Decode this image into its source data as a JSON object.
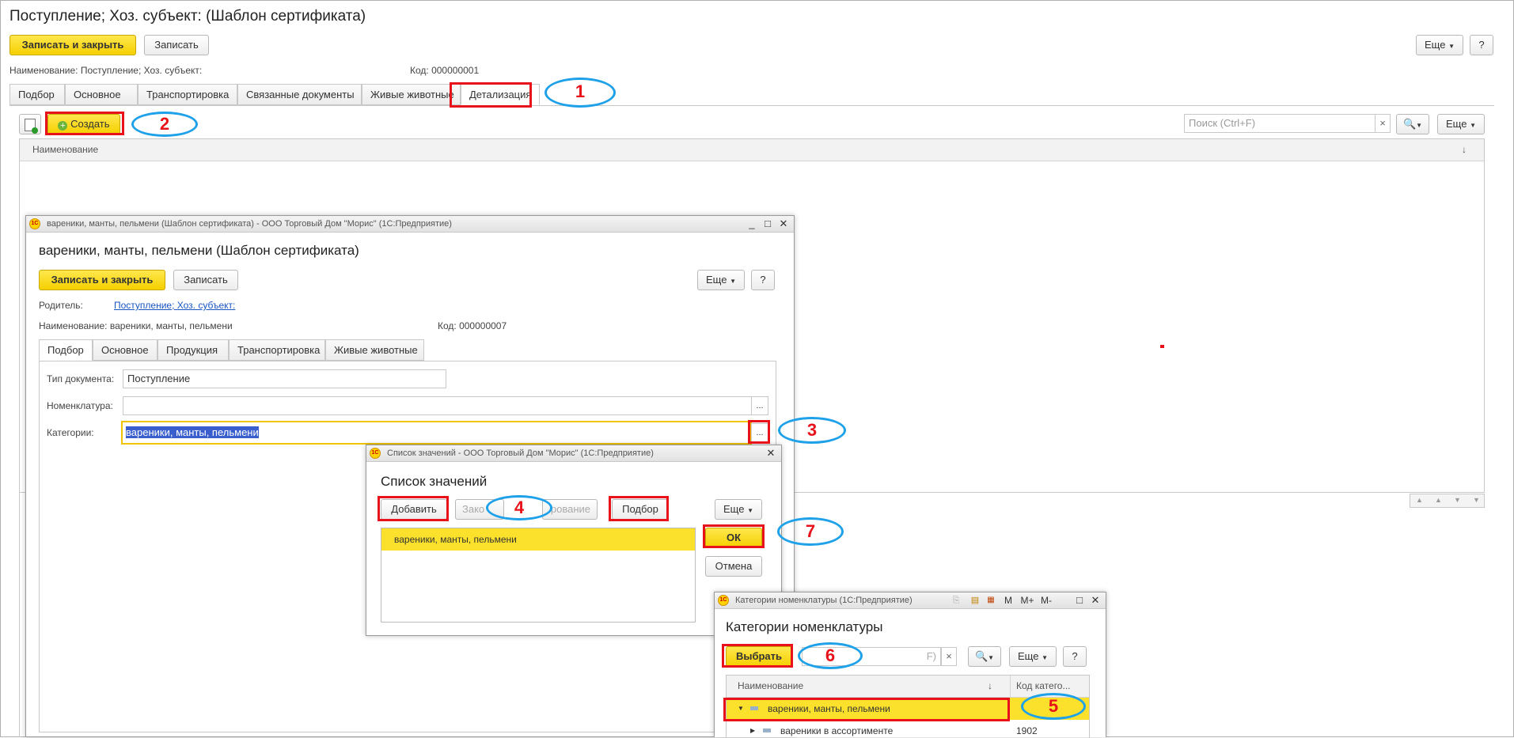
{
  "main": {
    "title": "Поступление; Хоз. субъект: (Шаблон сертификата)",
    "save_close": "Записать и закрыть",
    "save": "Записать",
    "more": "Еще",
    "help": "?",
    "name_label": "Наименование: Поступление; Хоз. субъект:",
    "code_label": "Код: 000000001",
    "tabs": [
      "Подбор",
      "Основное",
      "Транспортировка",
      "Связанные документы",
      "Живые животные",
      "Детализация"
    ],
    "create": "Создать",
    "search_placeholder": "Поиск (Ctrl+F)",
    "search_clear": "×",
    "more2": "Еще",
    "col_name": "Наименование",
    "sort_arrow": "↓"
  },
  "win1": {
    "titlebar": "вареники, манты, пельмени (Шаблон сертификата) - ООО Торговый Дом \"Морис\"  (1С:Предприятие)",
    "title": "вареники, манты, пельмени (Шаблон сертификата)",
    "save_close": "Записать и закрыть",
    "save": "Записать",
    "more": "Еще",
    "help": "?",
    "parent_label": "Родитель:",
    "parent_value": "Поступление; Хоз. субъект:",
    "name_label": "Наименование: вареники, манты, пельмени",
    "code_label": "Код: 000000007",
    "tabs": [
      "Подбор",
      "Основное",
      "Продукция",
      "Транспортировка",
      "Живые животные"
    ],
    "doc_type_label": "Тип документа:",
    "doc_type_value": "Поступление",
    "nomen_label": "Номенклатура:",
    "nomen_value": "",
    "cat_label": "Категории:",
    "cat_value": "вареники, манты, пельмени",
    "dots": "..."
  },
  "win2": {
    "titlebar": "Список значений - ООО Торговый Дом \"Морис\"  (1С:Предприятие)",
    "title": "Список значений",
    "add": "Добавить",
    "close_btn": "Зако",
    "copy_btn": "рование",
    "pick": "Подбор",
    "more": "Еще",
    "item": "вареники, манты, пельмени",
    "ok": "ОК",
    "cancel": "Отмена"
  },
  "win3": {
    "titlebar": "Категории номенклатуры  (1С:Предприятие)",
    "title": "Категории номенклатуры",
    "select": "Выбрать",
    "search_hint": "F)",
    "search_clear": "×",
    "more": "Еще",
    "help": "?",
    "col_name": "Наименование",
    "col_code": "Код катего...",
    "sort_arrow": "↓",
    "row1": "вареники, манты, пельмени",
    "row2": "вареники в ассортименте",
    "row2_code": "1902",
    "tb_m": "M",
    "tb_mplus": "M+",
    "tb_mminus": "M-"
  },
  "annotations": [
    "1",
    "2",
    "3",
    "4",
    "5",
    "6",
    "7"
  ],
  "colors": {
    "accent_yellow": "#f5d000",
    "annotation_red": "#e8121b",
    "annotation_blue": "#1ea1e8",
    "selection_yellow": "#fbe12b"
  }
}
